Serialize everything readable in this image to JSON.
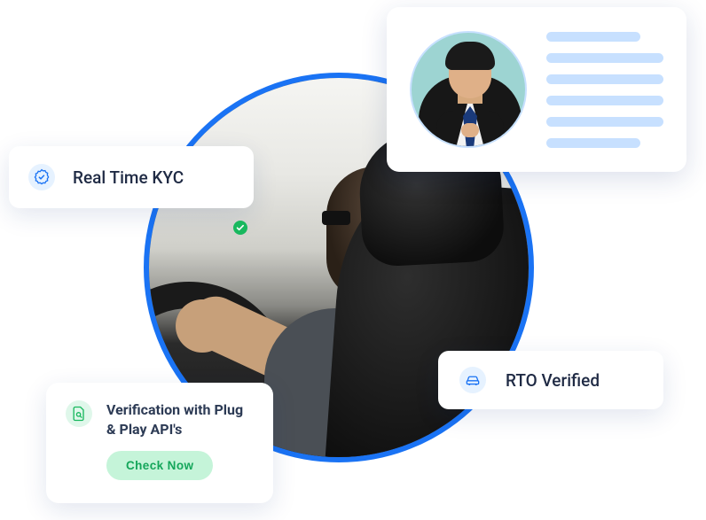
{
  "cards": {
    "kyc": {
      "label": "Real Time KYC"
    },
    "rto": {
      "label": "RTO Verified"
    },
    "api": {
      "title": "Verification with Plug & Play API's",
      "button": "Check  Now"
    }
  },
  "colors": {
    "accent_blue": "#1A73F4",
    "placeholder_blue": "#c7e0ff",
    "green": "#18b85e"
  }
}
